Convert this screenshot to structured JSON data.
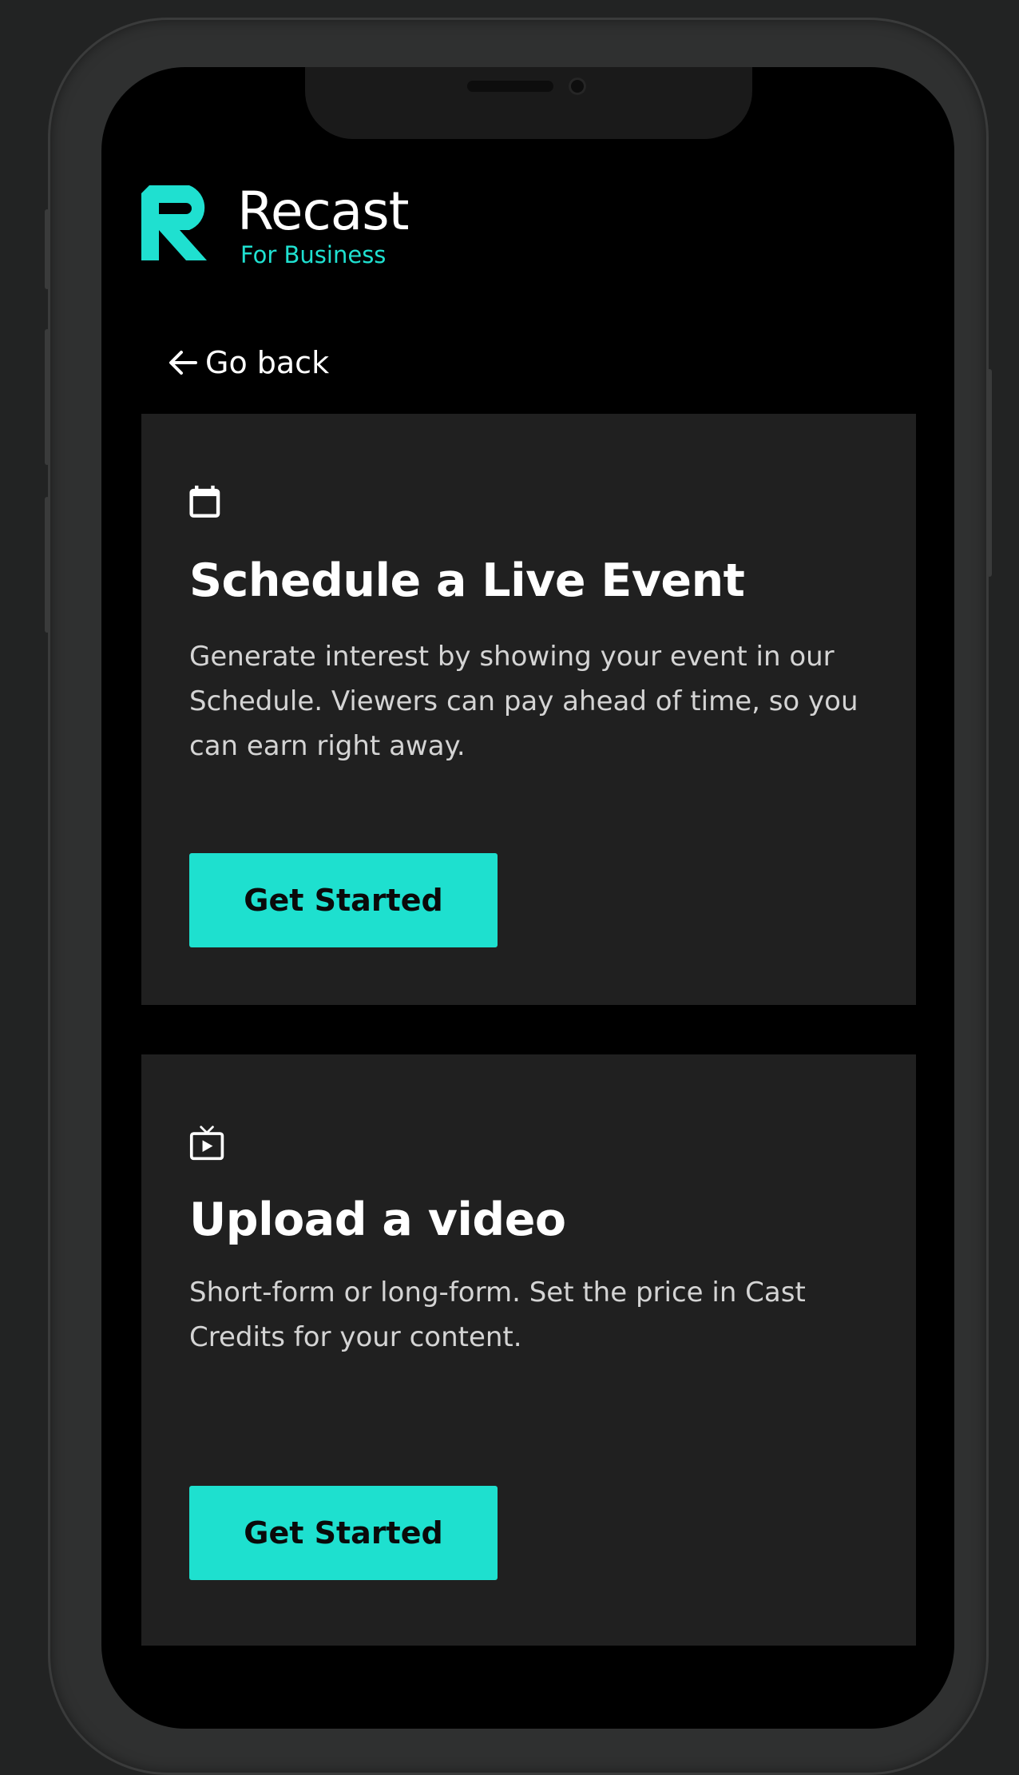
{
  "brand": {
    "name": "Recast",
    "tagline": "For Business",
    "accent_color": "#1fe0d0"
  },
  "nav": {
    "back_label": "Go back",
    "back_icon": "arrow-left-icon"
  },
  "cards": [
    {
      "icon": "calendar-icon",
      "title": "Schedule a Live Event",
      "description": "Generate interest by showing your event in our Schedule. Viewers can pay ahead of time, so you can earn right away.",
      "button_label": "Get Started"
    },
    {
      "icon": "tv-play-icon",
      "title": "Upload a video",
      "description": "Short-form or long-form. Set the price in Cast Credits for your content.",
      "button_label": "Get Started"
    }
  ],
  "colors": {
    "background": "#222323",
    "screen": "#000000",
    "card": "#202020",
    "button": "#1ee0cf"
  }
}
